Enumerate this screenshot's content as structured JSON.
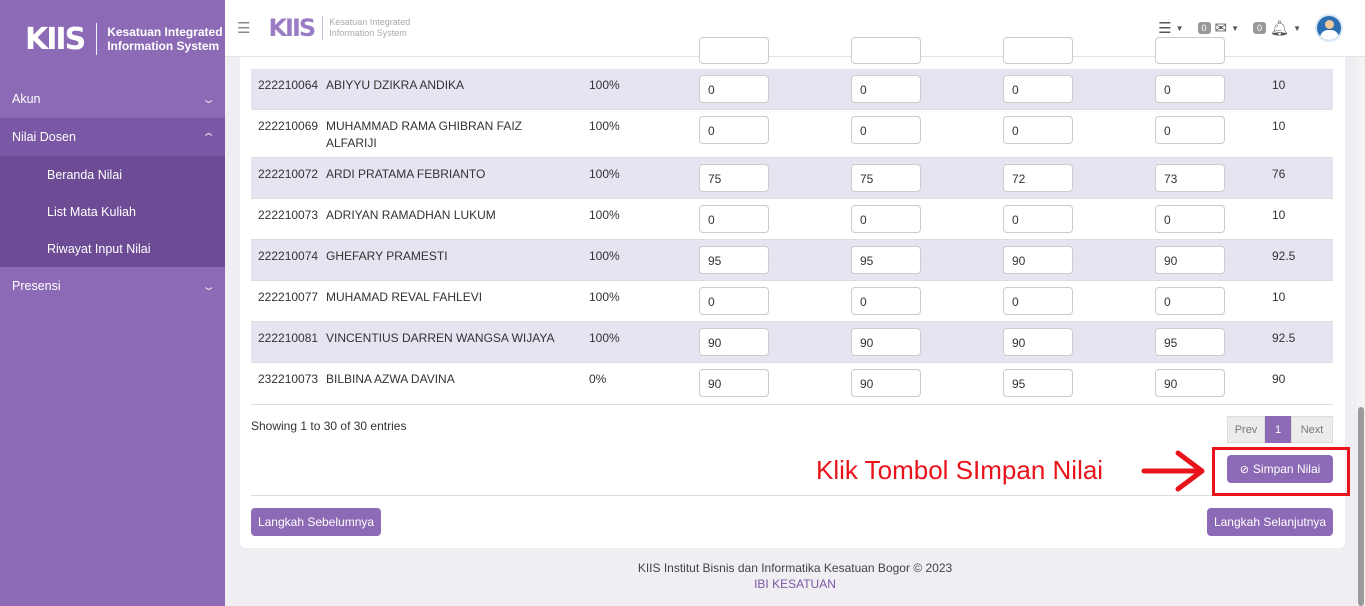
{
  "brand": {
    "logo": "KIIS",
    "line1": "Kesatuan Integrated",
    "line2": "Information System"
  },
  "sidebar": {
    "items": [
      {
        "label": "Akun"
      },
      {
        "label": "Nilai Dosen",
        "sub": [
          "Beranda Nilai",
          "List Mata Kuliah",
          "Riwayat Input Nilai"
        ]
      },
      {
        "label": "Presensi"
      }
    ]
  },
  "topbar": {
    "menu_icon": "hamburger-icon",
    "mail_count": "0",
    "bell_count": "0"
  },
  "table": {
    "rows": [
      {
        "nim": "222210064",
        "name": "ABIYYU DZIKRA ANDIKA",
        "pct": "100%",
        "v1": "0",
        "v2": "0",
        "v3": "0",
        "v4": "0",
        "final": "10"
      },
      {
        "nim": "222210069",
        "name": "MUHAMMAD RAMA GHIBRAN FAIZ ALFARIJI",
        "pct": "100%",
        "v1": "0",
        "v2": "0",
        "v3": "0",
        "v4": "0",
        "final": "10"
      },
      {
        "nim": "222210072",
        "name": "ARDI PRATAMA FEBRIANTO",
        "pct": "100%",
        "v1": "75",
        "v2": "75",
        "v3": "72",
        "v4": "73",
        "final": "76"
      },
      {
        "nim": "222210073",
        "name": "ADRIYAN RAMADHAN LUKUM",
        "pct": "100%",
        "v1": "0",
        "v2": "0",
        "v3": "0",
        "v4": "0",
        "final": "10"
      },
      {
        "nim": "222210074",
        "name": "GHEFARY PRAMESTI",
        "pct": "100%",
        "v1": "95",
        "v2": "95",
        "v3": "90",
        "v4": "90",
        "final": "92.5"
      },
      {
        "nim": "222210077",
        "name": "MUHAMAD REVAL FAHLEVI",
        "pct": "100%",
        "v1": "0",
        "v2": "0",
        "v3": "0",
        "v4": "0",
        "final": "10"
      },
      {
        "nim": "222210081",
        "name": "VINCENTIUS DARREN WANGSA WIJAYA",
        "pct": "100%",
        "v1": "90",
        "v2": "90",
        "v3": "90",
        "v4": "95",
        "final": "92.5"
      },
      {
        "nim": "232210073",
        "name": "BILBINA AZWA DAVINA",
        "pct": "0%",
        "v1": "90",
        "v2": "90",
        "v3": "95",
        "v4": "90",
        "final": "90"
      }
    ]
  },
  "showing": "Showing 1 to 30 of 30 entries",
  "pager": {
    "prev": "Prev",
    "page": "1",
    "next": "Next"
  },
  "buttons": {
    "save": "Simpan Nilai",
    "prev_step": "Langkah Sebelumnya",
    "next_step": "Langkah Selanjutnya"
  },
  "annotation": {
    "text": "Klik Tombol SImpan Nilai"
  },
  "footer": {
    "line1": "KIIS Institut Bisnis dan Informatika Kesatuan Bogor © 2023",
    "line2": "IBI KESATUAN"
  }
}
